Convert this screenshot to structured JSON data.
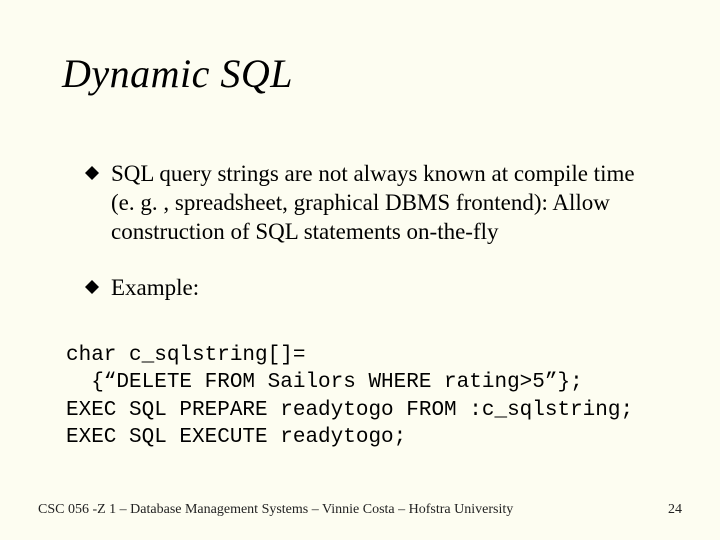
{
  "title": "Dynamic SQL",
  "bullets": [
    "SQL query strings are not always known at compile time (e. g. , spreadsheet, graphical DBMS frontend): Allow construction of SQL statements on-the-fly",
    "Example:"
  ],
  "code": "char c_sqlstring[]=\n  {“DELETE FROM Sailors WHERE rating>5”};\nEXEC SQL PREPARE readytogo FROM :c_sqlstring;\nEXEC SQL EXECUTE readytogo;",
  "footer_left": "CSC 056 -Z 1 – Database Management Systems – Vinnie Costa – Hofstra University",
  "footer_right": "24"
}
